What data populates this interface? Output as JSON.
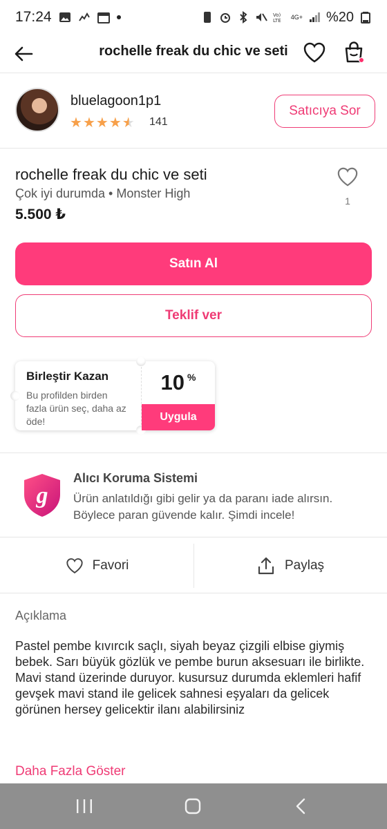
{
  "status_bar": {
    "time": "17:24",
    "battery": "%20",
    "net_label": "4G+"
  },
  "header": {
    "title": "rochelle freak du chic ve seti"
  },
  "seller": {
    "name": "bluelagoon1p1",
    "rating": 4.5,
    "rating_count": "141",
    "ask_label": "Satıcıya Sor"
  },
  "product": {
    "title": "rochelle freak du chic ve seti",
    "subtitle": "Çok iyi durumda • Monster High",
    "price": "5.500 ₺",
    "like_count": "1"
  },
  "buttons": {
    "buy": "Satın Al",
    "offer": "Teklif ver"
  },
  "bundle": {
    "title": "Birleştir Kazan",
    "description": "Bu profilden birden fazla ürün seç, daha az öde!",
    "percent": "10",
    "percent_sign": "%",
    "apply": "Uygula"
  },
  "protection": {
    "title": "Alıcı Koruma Sistemi",
    "description": "Ürün anlatıldığı gibi gelir ya da paranı iade alırsın. Böylece paran güvende kalır. Şimdi incele!"
  },
  "actions": {
    "favorite": "Favori",
    "share": "Paylaş"
  },
  "description": {
    "heading": "Açıklama",
    "body": "Pastel pembe kıvırcık saçlı, siyah beyaz çizgili elbise giymiş bebek. Sarı büyük gözlük ve pembe burun aksesuarı ile birlikte. Mavi stand üzerinde duruyor. kusursuz durumda eklemleri hafif gevşek mavi stand ile gelicek sahnesi eşyaları da gelicek görünen hersey gelicektir ilanı alabilirsiniz",
    "more": "Daha Fazla Göster"
  },
  "colors": {
    "accent": "#ff3b7b",
    "accent_text": "#ef3b75",
    "star": "#f7a04a",
    "nav_bar": "#8f8f8f"
  },
  "icons": [
    "back-arrow-icon",
    "heart-icon",
    "shopping-bag-icon",
    "shield-g-icon",
    "share-icon",
    "recent-apps-icon",
    "home-icon",
    "nav-back-icon"
  ]
}
